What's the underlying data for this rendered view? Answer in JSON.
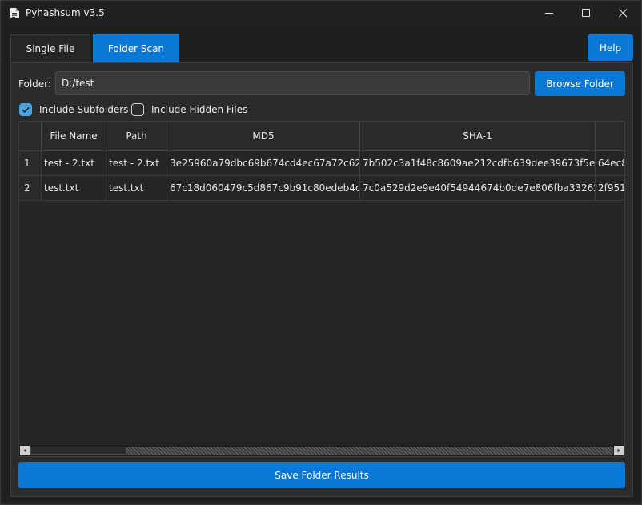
{
  "window": {
    "title": "Pyhashsum v3.5"
  },
  "tabs": [
    {
      "label": "Single File",
      "active": false
    },
    {
      "label": "Folder Scan",
      "active": true
    }
  ],
  "help_label": "Help",
  "folder": {
    "label": "Folder:",
    "value": "D:/test",
    "browse_label": "Browse Folder"
  },
  "options": {
    "include_subfolders": {
      "label": "Include Subfolders",
      "checked": true
    },
    "include_hidden": {
      "label": "Include Hidden Files",
      "checked": false
    }
  },
  "table": {
    "columns": [
      "File Name",
      "Path",
      "MD5",
      "SHA-1"
    ],
    "rows": [
      {
        "num": "1",
        "file_name": "test - 2.txt",
        "path": "test - 2.txt",
        "md5": "3e25960a79dbc69b674cd4ec67a72c62",
        "sha1": "7b502c3a1f48c8609ae212cdfb639dee39673f5e",
        "next": "64ec8"
      },
      {
        "num": "2",
        "file_name": "test.txt",
        "path": "test.txt",
        "md5": "67c18d060479c5d867c9b91c80edeb4c",
        "sha1": "7c0a529d2e9e40f54944674b0de7e806fba33262",
        "next": "2f951"
      }
    ]
  },
  "save_label": "Save Folder Results",
  "colors": {
    "accent": "#0a78d7",
    "checkbox": "#4aa4de",
    "background": "#1f1f1f",
    "panel": "#2b2b2b"
  }
}
